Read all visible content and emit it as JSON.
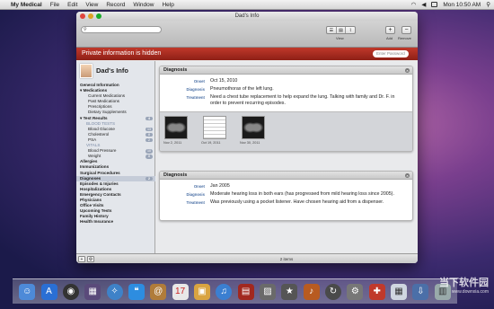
{
  "menubar": {
    "app": "My Medical",
    "menus": [
      "File",
      "Edit",
      "View",
      "Record",
      "Window",
      "Help"
    ],
    "clock": "Mon 10:50 AM"
  },
  "window": {
    "title": "Dad's Info",
    "toolbar": {
      "search_placeholder": "",
      "view_label": "View",
      "add_label": "Add",
      "remove_label": "Remove"
    },
    "banner": {
      "text": "Private information is hidden",
      "password_placeholder": "Enter Password"
    }
  },
  "sidebar": {
    "profile_name": "Dad's Info",
    "items": [
      {
        "label": "General Information",
        "kind": "sec"
      },
      {
        "label": "▾ Medications",
        "kind": "sec"
      },
      {
        "label": "Current Medications",
        "kind": "sub"
      },
      {
        "label": "Past Medications",
        "kind": "sub"
      },
      {
        "label": "Prescriptions",
        "kind": "sub"
      },
      {
        "label": "Dietary Supplements",
        "kind": "sub"
      },
      {
        "label": "▾ Test Results",
        "kind": "sec",
        "badge": "4"
      },
      {
        "label": "BLOOD TESTS",
        "kind": "hdr"
      },
      {
        "label": "Blood Glucose",
        "kind": "sub",
        "badge": "13"
      },
      {
        "label": "Cholesterol",
        "kind": "sub",
        "badge": "8"
      },
      {
        "label": "PSA",
        "kind": "sub",
        "badge": "2"
      },
      {
        "label": "VITALS",
        "kind": "hdr"
      },
      {
        "label": "Blood Pressure",
        "kind": "sub",
        "badge": "10"
      },
      {
        "label": "Weight",
        "kind": "sub",
        "badge": "8"
      },
      {
        "label": "Allergies",
        "kind": "sec"
      },
      {
        "label": "Immunizations",
        "kind": "sec"
      },
      {
        "label": "Surgical Procedures",
        "kind": "sec"
      },
      {
        "label": "Diagnoses",
        "kind": "sec",
        "badge": "2",
        "selected": true
      },
      {
        "label": "Episodes & Injuries",
        "kind": "sec"
      },
      {
        "label": "Hospitalizations",
        "kind": "sec"
      },
      {
        "label": "Emergency Contacts",
        "kind": "sec"
      },
      {
        "label": "Physicians",
        "kind": "sec"
      },
      {
        "label": "Office Visits",
        "kind": "sec"
      },
      {
        "label": "Upcoming Tests",
        "kind": "sec"
      },
      {
        "label": "Family History",
        "kind": "sec"
      },
      {
        "label": "Health Insurance",
        "kind": "sec"
      }
    ]
  },
  "diagnoses": [
    {
      "header": "Diagnosis",
      "fields": [
        {
          "label": "Onset",
          "value": "Oct 15, 2010"
        },
        {
          "label": "Diagnosis",
          "value": "Pneumothorax of the left lung."
        },
        {
          "label": "Treatment",
          "value": "Need a chest tube replacement to help expand the lung.  Talking with family and Dr. F. in order to prevent recurring episodes."
        }
      ],
      "attachments": [
        {
          "date": "Nov 2, 2011",
          "type": "xray"
        },
        {
          "date": "Oct 19, 2011",
          "type": "doc"
        },
        {
          "date": "Nov 30, 2011",
          "type": "xray"
        }
      ]
    },
    {
      "header": "Diagnosis",
      "fields": [
        {
          "label": "Onset",
          "value": "Jan 2005"
        },
        {
          "label": "Diagnosis",
          "value": "Moderate hearing loss in both ears (has progressed from mild hearing loss since 2005)."
        },
        {
          "label": "Treatment",
          "value": "Was previously using a pocket listener.  Have chosen hearing aid from a dispenser."
        }
      ]
    }
  ],
  "footer": {
    "count": "2 items"
  },
  "watermark": {
    "main": "当下软件园",
    "sub": "www.downxia.com"
  },
  "colors": {
    "banner": "#a8281d",
    "accent": "#4a6fa5"
  }
}
